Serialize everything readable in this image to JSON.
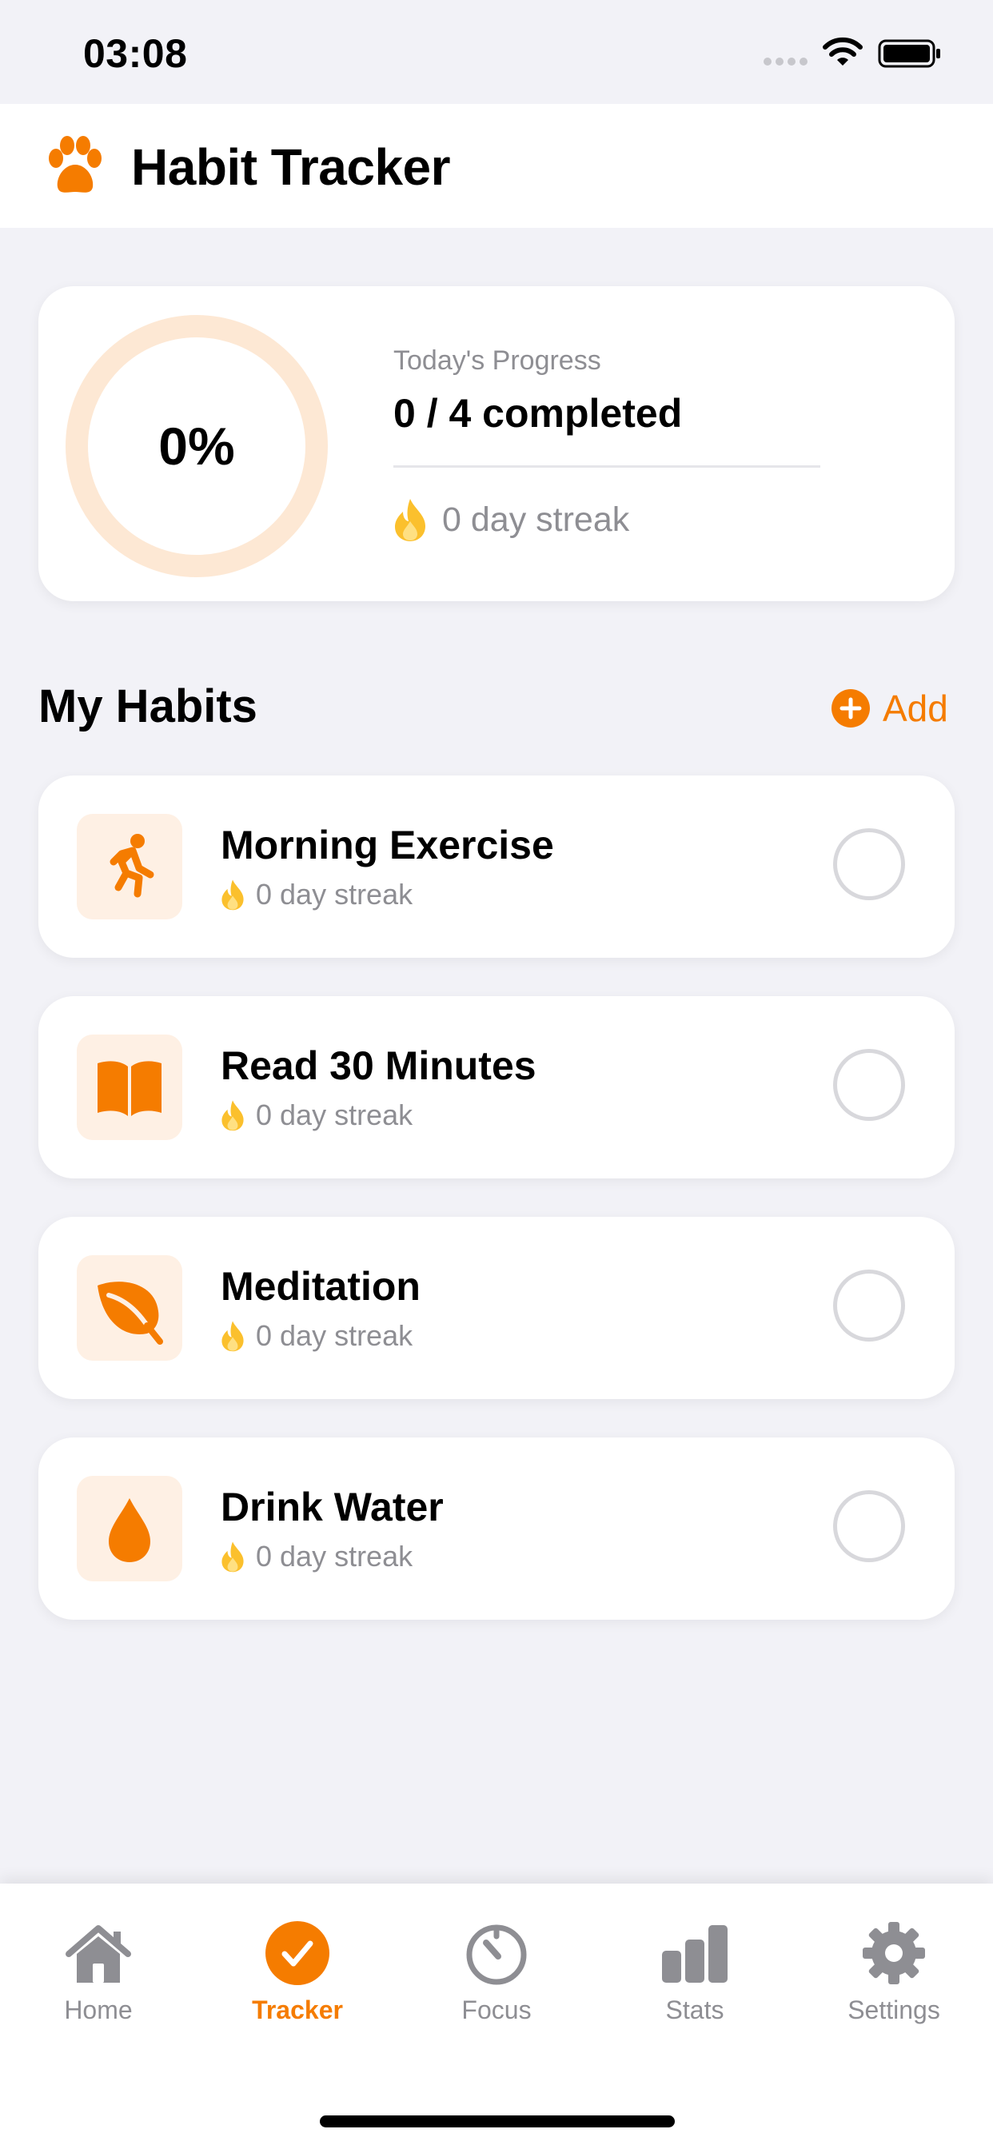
{
  "status_bar": {
    "time": "03:08"
  },
  "header": {
    "title": "Habit Tracker",
    "icon": "paw-icon"
  },
  "progress": {
    "percent_text": "0%",
    "fraction": 0,
    "label": "Today's Progress",
    "count_text": "0 / 4 completed",
    "streak_text": "0 day streak"
  },
  "habits_section": {
    "title": "My Habits",
    "add_label": "Add"
  },
  "habits": [
    {
      "name": "Morning Exercise",
      "streak": "0 day streak",
      "icon": "running-icon",
      "completed": false
    },
    {
      "name": "Read 30 Minutes",
      "streak": "0 day streak",
      "icon": "book-icon",
      "completed": false
    },
    {
      "name": "Meditation",
      "streak": "0 day streak",
      "icon": "leaf-icon",
      "completed": false
    },
    {
      "name": "Drink Water",
      "streak": "0 day streak",
      "icon": "water-drop-icon",
      "completed": false
    }
  ],
  "tab_bar": {
    "items": [
      {
        "label": "Home",
        "icon": "home-icon",
        "active": false
      },
      {
        "label": "Tracker",
        "icon": "checkmark-circle-icon",
        "active": true
      },
      {
        "label": "Focus",
        "icon": "timer-icon",
        "active": false
      },
      {
        "label": "Stats",
        "icon": "bar-chart-icon",
        "active": false
      },
      {
        "label": "Settings",
        "icon": "gear-icon",
        "active": false
      }
    ]
  },
  "colors": {
    "accent": "#f57c00",
    "ring_track": "#fde8d4",
    "flame": "#fbc02d",
    "icon_tile": "#fef0e4",
    "inactive": "#8e8e93",
    "background": "#f2f2f7"
  }
}
